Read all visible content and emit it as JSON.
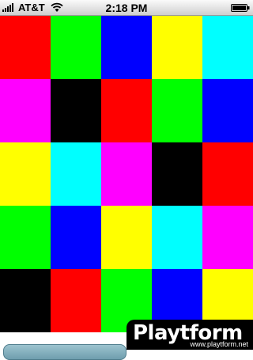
{
  "status_bar": {
    "carrier": "AT&T",
    "time": "2:18 PM",
    "signal_icon": "signal-bars-icon",
    "wifi_icon": "wifi-icon",
    "battery_icon": "battery-icon",
    "battery_level": 1.0
  },
  "palette": {
    "red": "#ff0000",
    "green": "#00ff00",
    "blue": "#0000ff",
    "yellow": "#ffff00",
    "cyan": "#00ffff",
    "magenta": "#ff00ff",
    "black": "#000000"
  },
  "board": {
    "rows": [
      [
        "red",
        "green",
        "blue",
        "yellow",
        "cyan"
      ],
      [
        "magenta",
        "black",
        "red",
        "green",
        "blue"
      ],
      [
        "yellow",
        "cyan",
        "magenta",
        "black",
        "red"
      ],
      [
        "green",
        "blue",
        "yellow",
        "cyan",
        "magenta"
      ],
      [
        "black",
        "red",
        "green",
        "blue",
        "yellow"
      ]
    ]
  },
  "watermark": {
    "logo": "Playtform",
    "url": "www.playtform.net"
  }
}
